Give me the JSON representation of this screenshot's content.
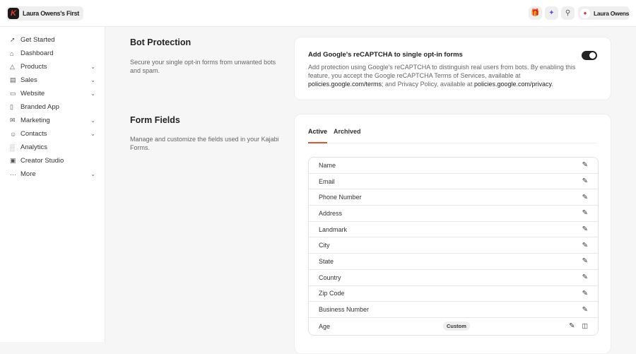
{
  "header": {
    "brand": "Laura Owens's First",
    "user": "Laura Owens"
  },
  "sidebar": {
    "items": [
      {
        "label": "Get Started",
        "icon": "rocket-icon",
        "chevron": false
      },
      {
        "label": "Dashboard",
        "icon": "home-icon",
        "chevron": false
      },
      {
        "label": "Products",
        "icon": "box-icon",
        "chevron": true
      },
      {
        "label": "Sales",
        "icon": "card-icon",
        "chevron": true
      },
      {
        "label": "Website",
        "icon": "monitor-icon",
        "chevron": true
      },
      {
        "label": "Branded App",
        "icon": "phone-icon",
        "chevron": false
      },
      {
        "label": "Marketing",
        "icon": "mail-icon",
        "chevron": true
      },
      {
        "label": "Contacts",
        "icon": "users-icon",
        "chevron": true
      },
      {
        "label": "Analytics",
        "icon": "chart-icon",
        "chevron": false
      },
      {
        "label": "Creator Studio",
        "icon": "studio-icon",
        "chevron": false
      },
      {
        "label": "More",
        "icon": "more-icon",
        "chevron": true
      }
    ]
  },
  "bot": {
    "title": "Bot Protection",
    "desc": "Secure your single opt-in forms from unwanted bots and spam.",
    "card_title": "Add Google's reCAPTCHA to single opt-in forms",
    "text1": "Add protection using Google's reCAPTCHA to distinguish real users from bots. By enabling this feature, you accept the Google reCAPTCHA Terms of Services, available at ",
    "link1": "policies.google.com/terms",
    "text2": "; and Privacy Policy, available at ",
    "link2": "policies.google.com/privacy",
    "text3": ".",
    "enabled": true
  },
  "fields": {
    "title": "Form Fields",
    "desc": "Manage and customize the fields used in your Kajabi Forms.",
    "tabs": [
      "Active",
      "Archived"
    ],
    "rows": [
      "Name",
      "Email",
      "Phone Number",
      "Address",
      "Landmark",
      "City",
      "State",
      "Country",
      "Zip Code",
      "Business Number",
      "Age"
    ],
    "custom_badge": "Custom"
  }
}
